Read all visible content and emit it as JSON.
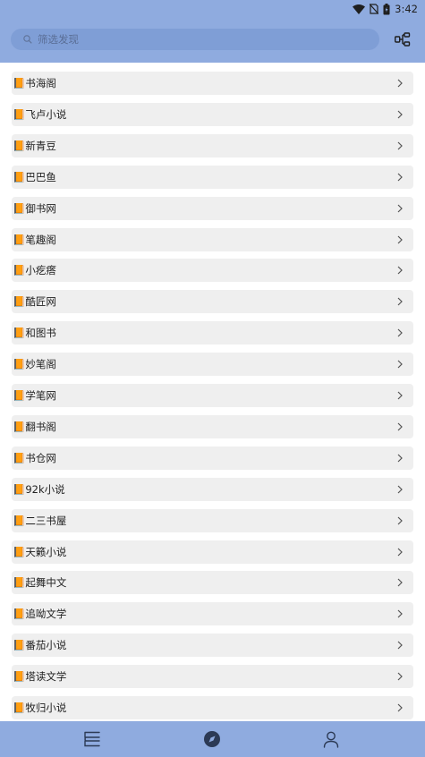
{
  "status": {
    "time": "3:42"
  },
  "search": {
    "placeholder": "筛选发现"
  },
  "menu": {
    "icon": "tree-menu-icon"
  },
  "items": [
    {
      "label": "📙书海阁"
    },
    {
      "label": "📙飞卢小说"
    },
    {
      "label": "📙新青豆"
    },
    {
      "label": "📙巴巴鱼"
    },
    {
      "label": "📙御书网"
    },
    {
      "label": "📙笔趣阁"
    },
    {
      "label": "📙小疙瘩"
    },
    {
      "label": "📙酷匠网"
    },
    {
      "label": "📙和图书"
    },
    {
      "label": "📙妙笔阁"
    },
    {
      "label": "📙学笔网"
    },
    {
      "label": "📙翻书阁"
    },
    {
      "label": "📙书仓网"
    },
    {
      "label": "📙92k小说"
    },
    {
      "label": "📙二三书屋"
    },
    {
      "label": "📙天籁小说"
    },
    {
      "label": "📙起舞中文"
    },
    {
      "label": "📙追呦文学"
    },
    {
      "label": "📙番茄小说"
    },
    {
      "label": "📙塔读文学"
    },
    {
      "label": "📙牧归小说"
    }
  ],
  "bottom_nav": [
    {
      "name": "bookshelf-icon",
      "active": false
    },
    {
      "name": "compass-icon",
      "active": true
    },
    {
      "name": "person-icon",
      "active": false
    }
  ],
  "colors": {
    "header": "#8fabdf",
    "search_bg": "#7f9ed6",
    "item_bg": "#efefef",
    "book_icon": "#e8a21a"
  }
}
